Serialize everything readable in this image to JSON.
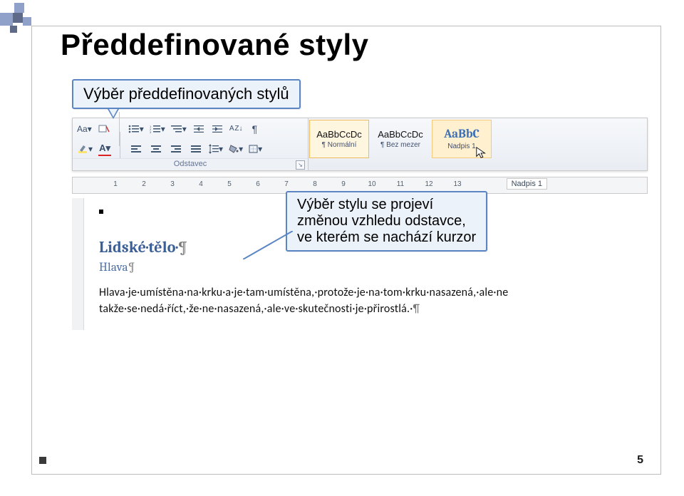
{
  "title": "Předdefinované styly",
  "callout1": "Výběr předdefinovaných stylů",
  "callout2_line1": "Výběr stylu se projeví",
  "callout2_line2": "změnou vzhledu odstavce,",
  "callout2_line3": "ve kterém se nachází kurzor",
  "ribbon": {
    "font_label_aa": "Aa",
    "group_paragraph": "Odstavec",
    "sort_az": "A Z",
    "pilcrow": "¶",
    "styles": [
      {
        "sample": "AaBbCcDc",
        "name": "¶ Normální",
        "selected": true
      },
      {
        "sample": "AaBbCcDc",
        "name": "¶ Bez mezer",
        "selected": false
      },
      {
        "sample": "AaBbC",
        "name": "Nadpis 1",
        "selected": false,
        "hover": true,
        "blue": true
      }
    ]
  },
  "ruler": {
    "numbers": [
      "1",
      "2",
      "3",
      "4",
      "5",
      "6",
      "7",
      "8",
      "9",
      "10",
      "11",
      "12",
      "13"
    ],
    "tip": "Nadpis 1"
  },
  "doc": {
    "heading": "Lidské·tělo·",
    "heading_pil": "¶",
    "sub": "Hlava",
    "sub_pil": "¶",
    "body1": "Hlava·je·umístěna·na·krku·a·je·tam·umístěna,·protože·je·na·tom·krku·nasazená,·ale·ne",
    "body2": "takže·se·nedá·říct,·že·ne·nasazená,·ale·ve·skutečnosti·je·přirostlá.·",
    "body_pil": "¶"
  },
  "page_number": "5"
}
